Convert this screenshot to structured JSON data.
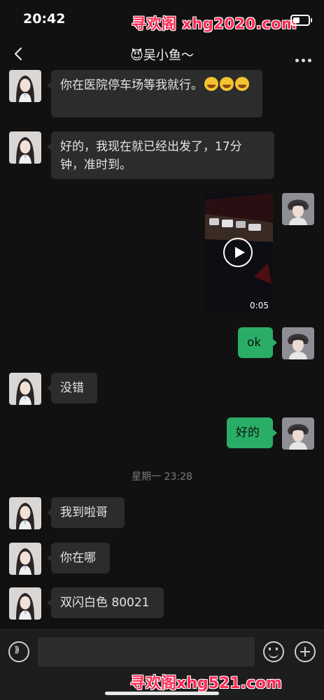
{
  "status": {
    "time": "20:42",
    "watermark": "寻欢阁 xhg2020.com"
  },
  "nav": {
    "title": "😈吴小鱼～"
  },
  "messages": {
    "m1": "你在医院停车场等我就行。",
    "m2": "好的，我现在就已经出发了，17分钟，准时到。",
    "video_duration": "0:05",
    "m3": "ok",
    "m4": "没错",
    "m5": "好的",
    "timestamp": "星期一 23:28",
    "m6": "我到啦哥",
    "m7": "你在哪",
    "m8": "双闪白色 80021"
  },
  "bottom": {
    "watermark": "寻欢阁xhg521.com"
  },
  "colors": {
    "self_bubble": "#2aae67",
    "other_bubble": "#2c2c2c",
    "background": "#111111",
    "watermark": "#ff2a55"
  },
  "icons": [
    "back-icon",
    "more-icon",
    "play-icon",
    "voice-icon",
    "emoji-icon",
    "plus-icon",
    "battery-icon"
  ]
}
